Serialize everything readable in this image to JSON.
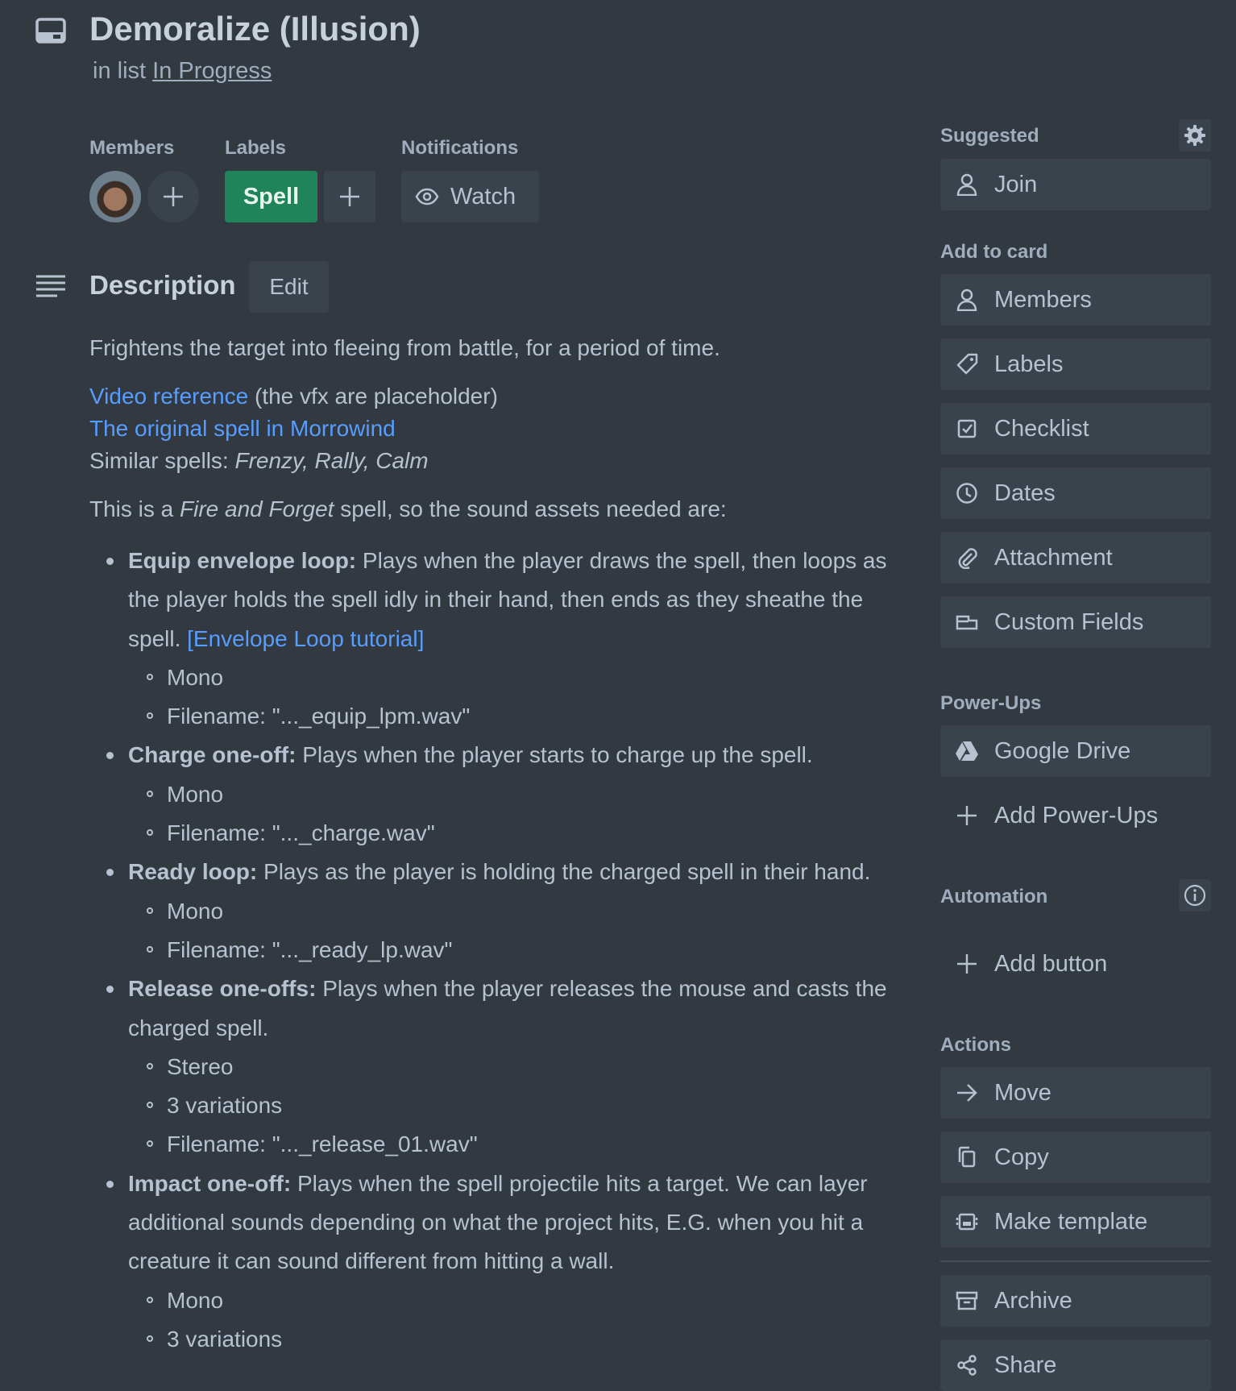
{
  "card": {
    "title": "Demoralize (Illusion)",
    "in_list_prefix": "in list",
    "list_name": "In Progress"
  },
  "members": {
    "label": "Members"
  },
  "labels": {
    "label": "Labels",
    "items": [
      {
        "name": "Spell",
        "color": "#1f845a"
      }
    ]
  },
  "notifications": {
    "label": "Notifications",
    "watch_label": "Watch"
  },
  "description": {
    "title": "Description",
    "edit_label": "Edit",
    "intro": "Frightens the target into fleeing from battle, for a period of time.",
    "link_video": "Video reference",
    "video_note": "(the vfx are placeholder)",
    "link_original": "The original spell in Morrowind",
    "similar_prefix": "Similar spells:",
    "similar_list": "Frenzy, Rally, Calm",
    "faf_pre": "This is a",
    "faf_em": "Fire and Forget",
    "faf_post": "spell, so the sound assets needed are:",
    "items": [
      {
        "bold": "Equip envelope loop:",
        "text": "Plays when the player draws the spell, then loops as the player holds the spell idly in their hand, then ends as they sheathe the spell.",
        "link": "[Envelope Loop tutorial]",
        "subs": [
          "Mono",
          "Filename: \"..._equip_lpm.wav\""
        ]
      },
      {
        "bold": "Charge one-off:",
        "text": "Plays when the player starts to charge up the spell.",
        "subs": [
          "Mono",
          "Filename: \"..._charge.wav\""
        ]
      },
      {
        "bold": "Ready loop:",
        "text": "Plays as the player is holding the charged spell in their hand.",
        "subs": [
          "Mono",
          "Filename: \"..._ready_lp.wav\""
        ]
      },
      {
        "bold": "Release one-offs:",
        "text": "Plays when the player releases the mouse and casts the charged spell.",
        "subs": [
          "Stereo",
          "3 variations",
          "Filename: \"..._release_01.wav\""
        ]
      },
      {
        "bold": "Impact one-off:",
        "text": "Plays when the spell projectile hits a target. We can layer additional sounds depending on what the project hits, E.G. when you hit a creature it can sound different from hitting a wall.",
        "subs": [
          "Mono",
          "3 variations"
        ]
      }
    ]
  },
  "sidebar": {
    "suggested": {
      "heading": "Suggested",
      "join": "Join"
    },
    "add_to_card": {
      "heading": "Add to card",
      "members": "Members",
      "labels": "Labels",
      "checklist": "Checklist",
      "dates": "Dates",
      "attachment": "Attachment",
      "custom_fields": "Custom Fields"
    },
    "power_ups": {
      "heading": "Power-Ups",
      "google_drive": "Google Drive",
      "add_power_ups": "Add Power-Ups"
    },
    "automation": {
      "heading": "Automation",
      "add_button": "Add button"
    },
    "actions": {
      "heading": "Actions",
      "move": "Move",
      "copy": "Copy",
      "make_template": "Make template",
      "archive": "Archive",
      "share": "Share"
    }
  },
  "colors": {
    "background": "#323940",
    "button": "#3a424b",
    "link": "#579dff",
    "label_green": "#1f845a"
  }
}
